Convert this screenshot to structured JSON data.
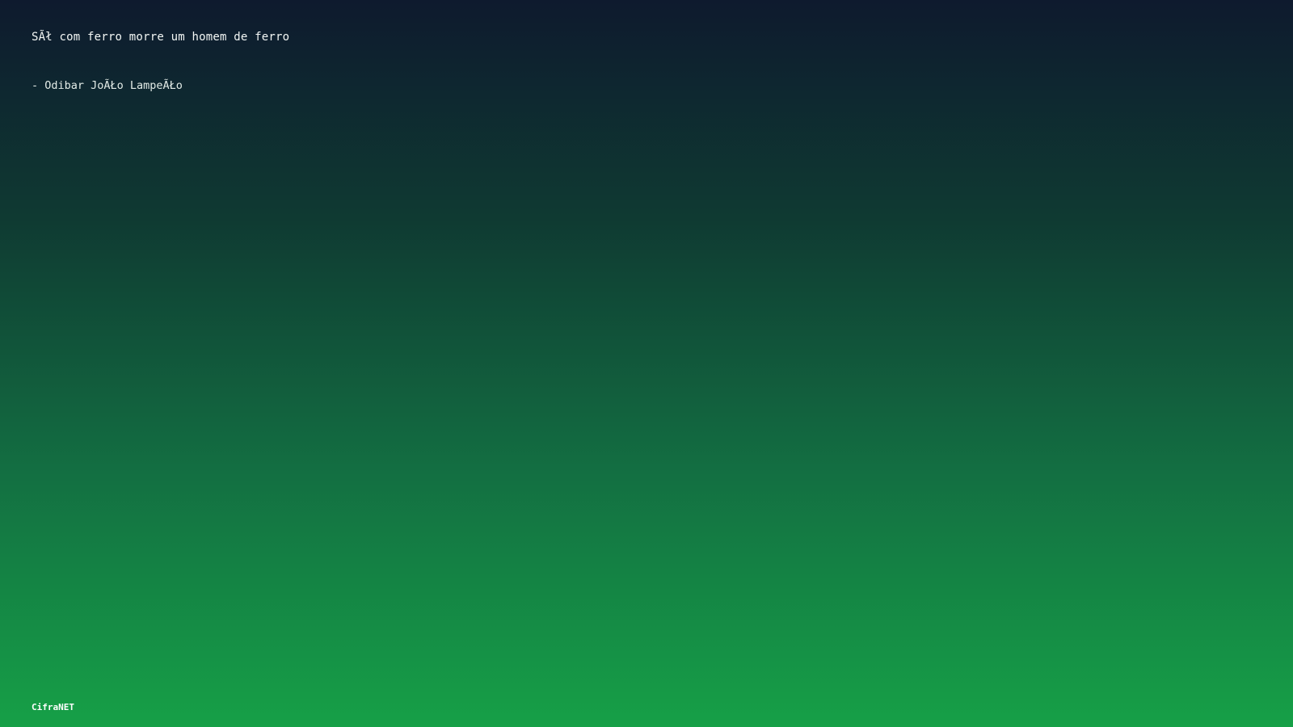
{
  "quote": {
    "text": "SÃł com ferro morre um homem de ferro",
    "author": "- Odibar JoÃŁo LampeÃŁo"
  },
  "footer": {
    "brand": "CifraNET"
  },
  "colors": {
    "gradient_top": "#0e1a2e",
    "gradient_bottom": "#16a047",
    "text": "#ffffff"
  }
}
